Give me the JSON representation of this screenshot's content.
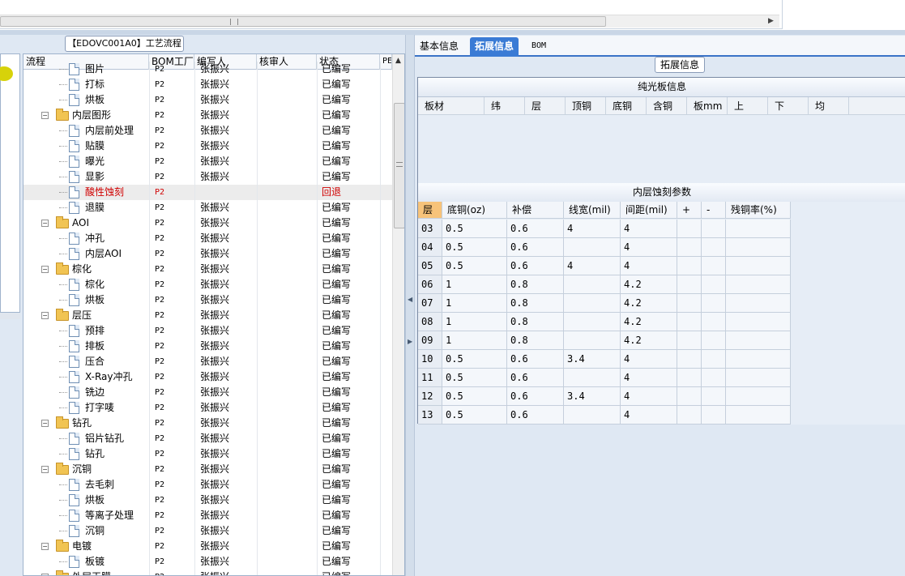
{
  "top_scroll": {
    "right_arrow": "▶"
  },
  "left_panel": {
    "group_title": "【EDOVC001A0】工艺流程",
    "columns": [
      "流程",
      "BOM工厂",
      "编写人",
      "核审人",
      "状态",
      "PE"
    ],
    "rows": [
      {
        "label": "图片",
        "type": "doc",
        "bom": "P2",
        "author": "张振兴",
        "status": "已编写"
      },
      {
        "label": "打标",
        "type": "doc",
        "bom": "P2",
        "author": "张振兴",
        "status": "已编写"
      },
      {
        "label": "烘板",
        "type": "doc",
        "bom": "P2",
        "author": "张振兴",
        "status": "已编写"
      },
      {
        "label": "内层图形",
        "type": "folder",
        "bom": "P2",
        "author": "张振兴",
        "status": "已编写"
      },
      {
        "label": "内层前处理",
        "type": "doc",
        "bom": "P2",
        "author": "张振兴",
        "status": "已编写"
      },
      {
        "label": "贴膜",
        "type": "doc",
        "bom": "P2",
        "author": "张振兴",
        "status": "已编写"
      },
      {
        "label": "曝光",
        "type": "doc",
        "bom": "P2",
        "author": "张振兴",
        "status": "已编写"
      },
      {
        "label": "显影",
        "type": "doc",
        "bom": "P2",
        "author": "张振兴",
        "status": "已编写"
      },
      {
        "label": "酸性蚀刻",
        "type": "doc",
        "bom": "P2",
        "author": "",
        "status": "回退",
        "selected": true
      },
      {
        "label": "退膜",
        "type": "doc",
        "bom": "P2",
        "author": "张振兴",
        "status": "已编写"
      },
      {
        "label": "AOI",
        "type": "folder",
        "bom": "P2",
        "author": "张振兴",
        "status": "已编写"
      },
      {
        "label": "冲孔",
        "type": "doc",
        "bom": "P2",
        "author": "张振兴",
        "status": "已编写"
      },
      {
        "label": "内层AOI",
        "type": "doc",
        "bom": "P2",
        "author": "张振兴",
        "status": "已编写"
      },
      {
        "label": "棕化",
        "type": "folder",
        "bom": "P2",
        "author": "张振兴",
        "status": "已编写"
      },
      {
        "label": "棕化",
        "type": "doc",
        "bom": "P2",
        "author": "张振兴",
        "status": "已编写"
      },
      {
        "label": "烘板",
        "type": "doc",
        "bom": "P2",
        "author": "张振兴",
        "status": "已编写"
      },
      {
        "label": "层压",
        "type": "folder",
        "bom": "P2",
        "author": "张振兴",
        "status": "已编写"
      },
      {
        "label": "预排",
        "type": "doc",
        "bom": "P2",
        "author": "张振兴",
        "status": "已编写"
      },
      {
        "label": "排板",
        "type": "doc",
        "bom": "P2",
        "author": "张振兴",
        "status": "已编写"
      },
      {
        "label": "压合",
        "type": "doc",
        "bom": "P2",
        "author": "张振兴",
        "status": "已编写"
      },
      {
        "label": "X-Ray冲孔",
        "type": "doc",
        "bom": "P2",
        "author": "张振兴",
        "status": "已编写"
      },
      {
        "label": "铣边",
        "type": "doc",
        "bom": "P2",
        "author": "张振兴",
        "status": "已编写"
      },
      {
        "label": "打字唛",
        "type": "doc",
        "bom": "P2",
        "author": "张振兴",
        "status": "已编写"
      },
      {
        "label": "钻孔",
        "type": "folder",
        "bom": "P2",
        "author": "张振兴",
        "status": "已编写"
      },
      {
        "label": "铝片钻孔",
        "type": "doc",
        "bom": "P2",
        "author": "张振兴",
        "status": "已编写"
      },
      {
        "label": "钻孔",
        "type": "doc",
        "bom": "P2",
        "author": "张振兴",
        "status": "已编写"
      },
      {
        "label": "沉铜",
        "type": "folder",
        "bom": "P2",
        "author": "张振兴",
        "status": "已编写"
      },
      {
        "label": "去毛刺",
        "type": "doc",
        "bom": "P2",
        "author": "张振兴",
        "status": "已编写"
      },
      {
        "label": "烘板",
        "type": "doc",
        "bom": "P2",
        "author": "张振兴",
        "status": "已编写"
      },
      {
        "label": "等离子处理",
        "type": "doc",
        "bom": "P2",
        "author": "张振兴",
        "status": "已编写"
      },
      {
        "label": "沉铜",
        "type": "doc",
        "bom": "P2",
        "author": "张振兴",
        "status": "已编写"
      },
      {
        "label": "电镀",
        "type": "folder",
        "bom": "P2",
        "author": "张振兴",
        "status": "已编写"
      },
      {
        "label": "板镀",
        "type": "doc",
        "bom": "P2",
        "author": "张振兴",
        "status": "已编写"
      },
      {
        "label": "外层干膜",
        "type": "folder",
        "bom": "P2",
        "author": "张振兴",
        "status": "已编写"
      }
    ]
  },
  "right_panel": {
    "tabs": [
      "基本信息",
      "拓展信息",
      "BOM"
    ],
    "active_tab": "拓展信息",
    "group_title": "拓展信息",
    "copper_section": {
      "title": "纯光板信息",
      "columns": [
        "板材",
        "纬",
        "层",
        "顶铜",
        "底铜",
        "含铜",
        "板mm",
        "上",
        "下",
        "均"
      ]
    },
    "etch_section": {
      "title": "内层蚀刻参数",
      "columns": [
        "层",
        "底铜(oz)",
        "补偿",
        "线宽(mil)",
        "间距(mil)",
        "+",
        "-",
        "残铜率(%)"
      ],
      "rows": [
        [
          "03",
          "0.5",
          "0.6",
          "4",
          "4",
          "",
          "",
          ""
        ],
        [
          "04",
          "0.5",
          "0.6",
          "",
          "4",
          "",
          "",
          ""
        ],
        [
          "05",
          "0.5",
          "0.6",
          "4",
          "4",
          "",
          "",
          ""
        ],
        [
          "06",
          "1",
          "0.8",
          "",
          "4.2",
          "",
          "",
          ""
        ],
        [
          "07",
          "1",
          "0.8",
          "",
          "4.2",
          "",
          "",
          ""
        ],
        [
          "08",
          "1",
          "0.8",
          "",
          "4.2",
          "",
          "",
          ""
        ],
        [
          "09",
          "1",
          "0.8",
          "",
          "4.2",
          "",
          "",
          ""
        ],
        [
          "10",
          "0.5",
          "0.6",
          "3.4",
          "4",
          "",
          "",
          ""
        ],
        [
          "11",
          "0.5",
          "0.6",
          "",
          "4",
          "",
          "",
          ""
        ],
        [
          "12",
          "0.5",
          "0.6",
          "3.4",
          "4",
          "",
          "",
          ""
        ],
        [
          "13",
          "0.5",
          "0.6",
          "",
          "4",
          "",
          "",
          ""
        ]
      ]
    }
  }
}
